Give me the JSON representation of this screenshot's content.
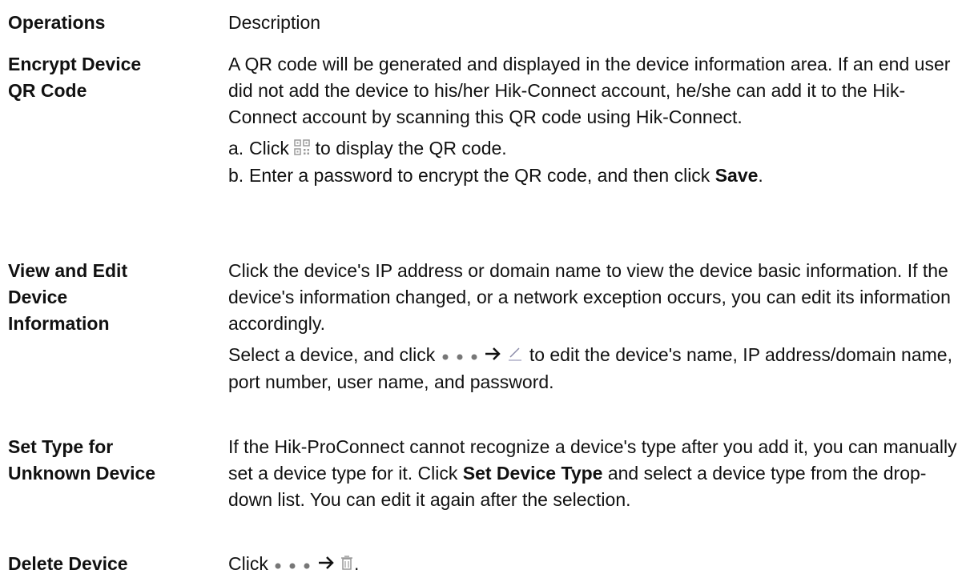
{
  "header": {
    "operations": "Operations",
    "description": "Description"
  },
  "rows": [
    {
      "operation_lines": [
        "Encrypt Device",
        "QR Code"
      ],
      "description": "A QR code will be generated and displayed in the device information area. If an end user did not add the device to his/her Hik-Connect account, he/she can add it to the Hik-Connect account by scanning this QR code using Hik-Connect.",
      "steps": [
        {
          "marker": "a.",
          "before": "Click",
          "icon": "qr-code-icon",
          "after": "to display the QR code."
        },
        {
          "marker": "b.",
          "before": "Enter a password to encrypt the QR code, and then click",
          "bold": "Save",
          "after": "."
        }
      ]
    },
    {
      "operation_lines": [
        "View and Edit",
        "Device",
        "Information"
      ],
      "description": "Click the device's IP address or domain name to view the device basic information. If the device's information changed, or a network exception occurs, you can edit its information accordingly.",
      "extra": {
        "before": "Select a device, and click",
        "icons": [
          "more-dots-icon",
          "arrow-right-icon",
          "edit-pencil-icon"
        ],
        "after": "to edit the device's name, IP address/domain name, port number, user name, and password."
      }
    },
    {
      "operation_lines": [
        "Set Type for",
        "Unknown Device"
      ],
      "description_before": "If the Hik-ProConnect cannot recognize a device's type after you add it, you can manually set a device type for it. Click",
      "description_bold": "Set Device Type",
      "description_after": "and select a device type from the drop-down list. You can edit it again after the selection."
    },
    {
      "operation_lines": [
        "Delete Device"
      ],
      "before": "Click",
      "icons": [
        "more-dots-icon",
        "arrow-right-icon",
        "trash-icon"
      ],
      "after": "."
    }
  ]
}
